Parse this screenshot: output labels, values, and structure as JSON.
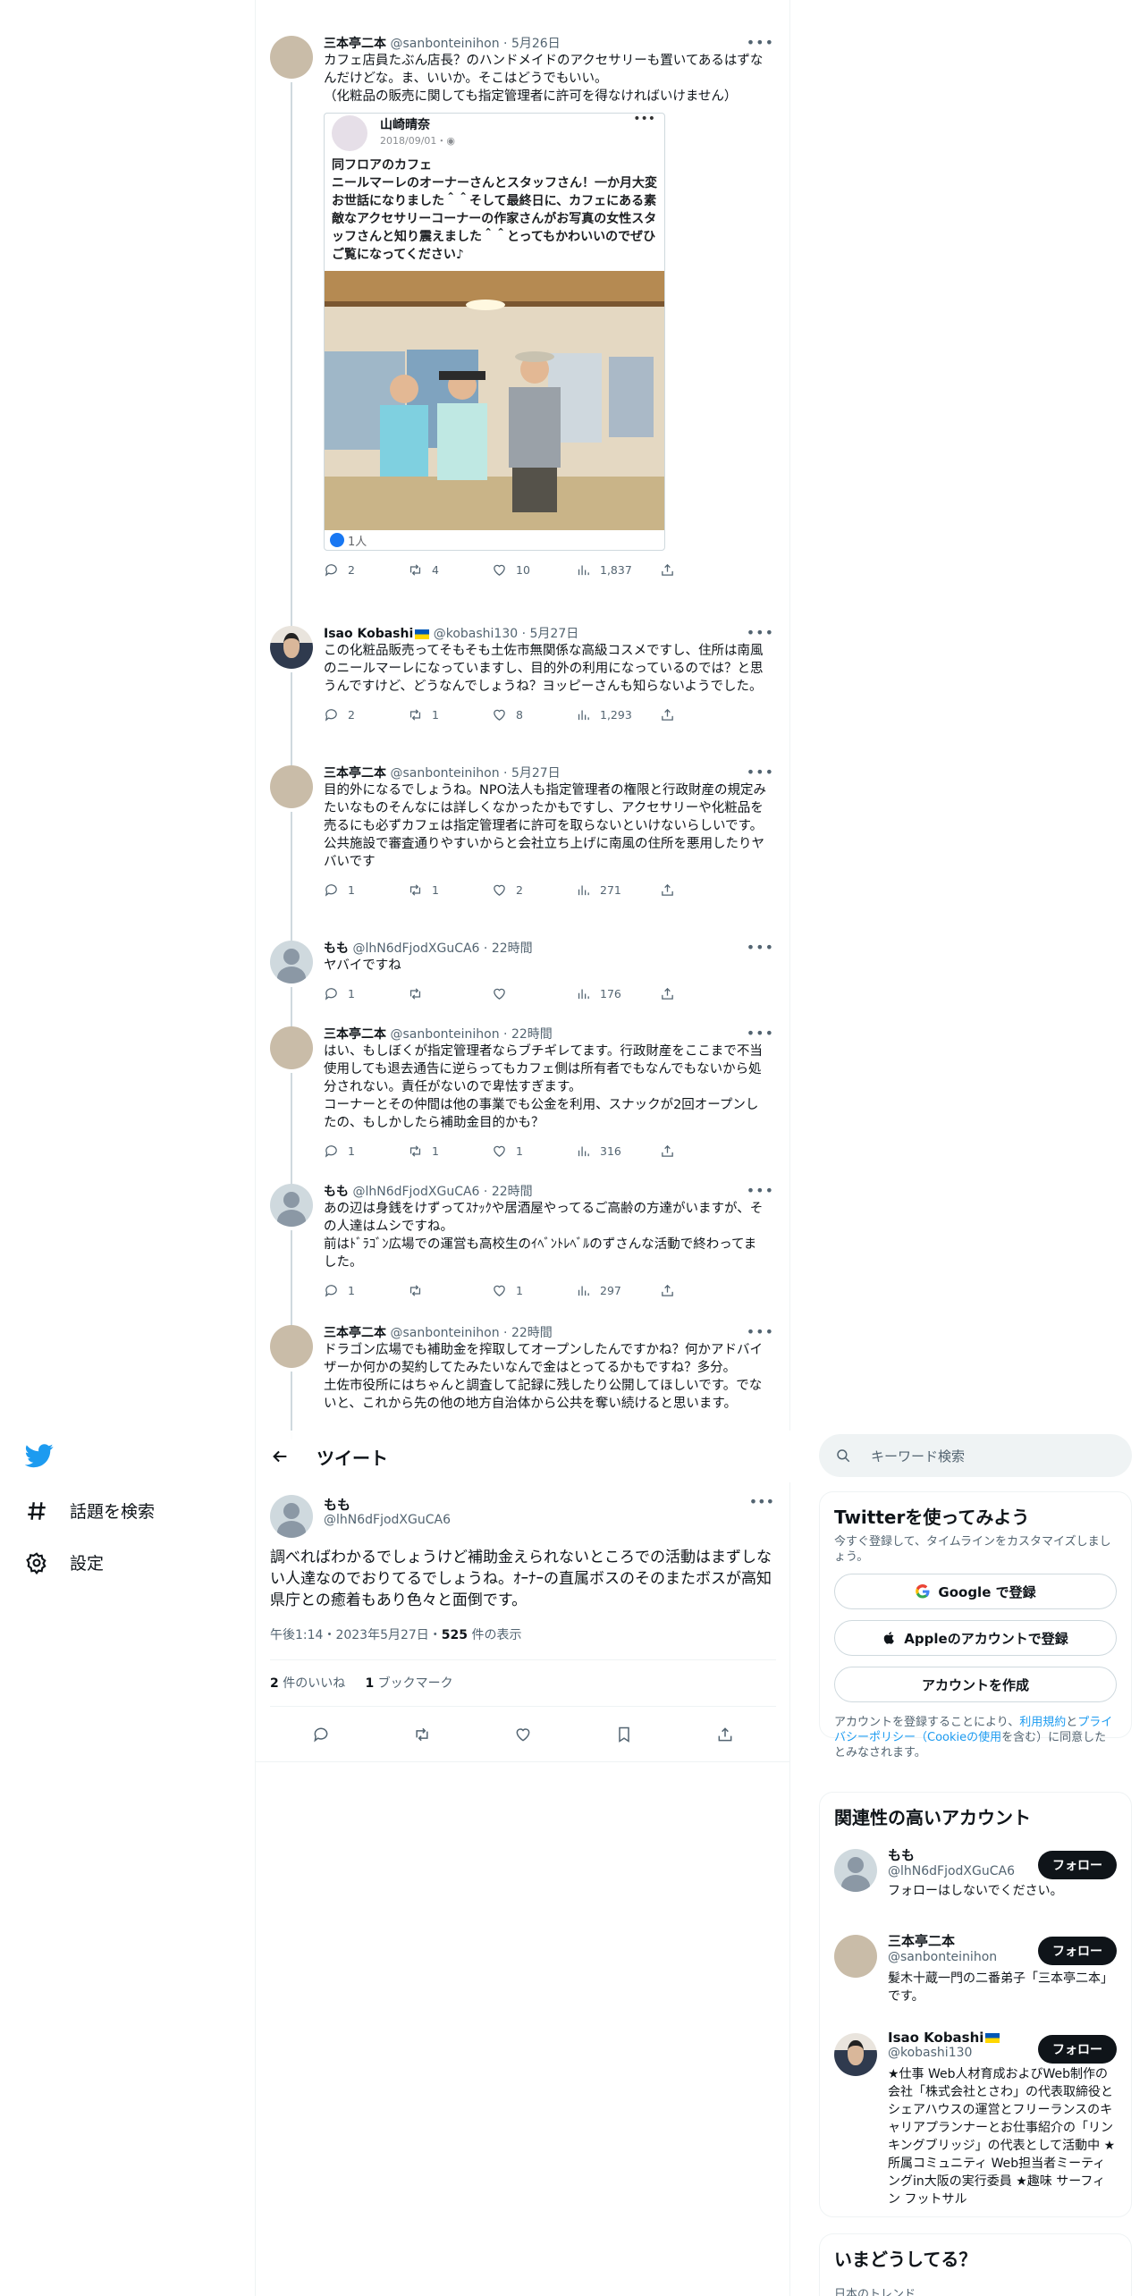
{
  "nav": {
    "explore_label": "話題を検索",
    "settings_label": "設定"
  },
  "thread": [
    {
      "name": "三本亭二本",
      "handle": "@sanbonteinihon",
      "time": "5月26日",
      "text": "カフェ店員たぶん店長？のハンドメイドのアクセサリーも置いてあるはずなんだけどな。ま、いいか。そこはどうでもいい。\n（化粧品の販売に関しても指定管理者に許可を得なければいけません）",
      "embed": {
        "name": "山崎晴奈",
        "date": "2018/09/01・",
        "text": "同フロアのカフェ\nニールマーレのオーナーさんとスタッフさん！一か月大変お世話になりました＾＾そして最終日に、カフェにある素敵なアクセサリーコーナーの作家さんがお写真の女性スタッフさんと知り震えました＾＾とってもかわいいのでぜひご覧になってください♪",
        "likes": "1人"
      },
      "replies": "2",
      "retweets": "4",
      "likes": "10",
      "views": "1,837"
    },
    {
      "name": "Isao Kobashi",
      "handle": "@kobashi130",
      "time": "5月27日",
      "text": "この化粧品販売ってそもそも土佐市無関係な高級コスメですし、住所は南風のニールマーレになっていますし、目的外の利用になっているのでは？と思うんですけど、どうなんでしょうね？ヨッピーさんも知らないようでした。",
      "replies": "2",
      "retweets": "1",
      "likes": "8",
      "views": "1,293"
    },
    {
      "name": "三本亭二本",
      "handle": "@sanbonteinihon",
      "time": "5月27日",
      "text": "目的外になるでしょうね。NPO法人も指定管理者の権限と行政財産の規定みたいなものそんなには詳しくなかったかもですし、アクセサリーや化粧品を売るにも必ずカフェは指定管理者に許可を取らないといけないらしいです。\n公共施設で審査通りやすいからと会社立ち上げに南風の住所を悪用したりヤバいです",
      "replies": "1",
      "retweets": "1",
      "likes": "2",
      "views": "271"
    },
    {
      "name": "もも",
      "handle": "@lhN6dFjodXGuCA6",
      "time": "22時間",
      "text": "ヤバイですね",
      "replies": "1",
      "retweets": "",
      "likes": "",
      "views": "176"
    },
    {
      "name": "三本亭二本",
      "handle": "@sanbonteinihon",
      "time": "22時間",
      "text": "はい、もしぼくが指定管理者ならブチギレてます。行政財産をここまで不当使用しても退去通告に逆らってもカフェ側は所有者でもなんでもないから処分されない。責任がないので卑怯すぎます。\nコーナーとその仲間は他の事業でも公金を利用、スナックが2回オープンしたの、もしかしたら補助金目的かも？",
      "replies": "1",
      "retweets": "1",
      "likes": "1",
      "views": "316"
    },
    {
      "name": "もも",
      "handle": "@lhN6dFjodXGuCA6",
      "time": "22時間",
      "text": "あの辺は身銭をけずってｽﾅｯｸや居酒屋やってるご高齢の方達がいますが、その人達はムシですね。\n前はﾄﾞﾗｺﾞﾝ広場での運営も高校生のｲﾍﾞﾝﾄﾚﾍﾞﾙのずさんな活動で終わってました。",
      "replies": "1",
      "retweets": "",
      "likes": "1",
      "views": "297"
    },
    {
      "name": "三本亭二本",
      "handle": "@sanbonteinihon",
      "time": "22時間",
      "text": "ドラゴン広場でも補助金を搾取してオープンしたんですかね？何かアドバイザーか何かの契約してたみたいなんで金はとってるかもですね？多分。\n土佐市役所にはちゃんと調査して記録に残したり公開してほしいです。でないと、これから先の他の地方自治体から公共を奪い続けると思います。",
      "replies": "",
      "retweets": "",
      "likes": "",
      "views": ""
    }
  ],
  "header": {
    "title": "ツイート"
  },
  "detail": {
    "name": "もも",
    "handle": "@lhN6dFjodXGuCA6",
    "text": "調べればわかるでしょうけど補助金えられないところでの活動はまずしない人達なのでおりてるでしょうね。ｵｰﾅｰの直属ボスのそのまたボスが高知県庁との癒着もあり色々と面倒です。",
    "time_prefix": "午後1:14・2023年5月27日・",
    "views_count": "525",
    "views_suffix": " 件の表示",
    "likes_count": "2",
    "likes_suffix": " 件のいいね",
    "bookmarks_count": "1",
    "bookmarks_suffix": " ブックマーク"
  },
  "search": {
    "placeholder": "キーワード検索"
  },
  "signup": {
    "title": "Twitterを使ってみよう",
    "subtitle": "今すぐ登録して、タイムラインをカスタマイズしましょう。",
    "google": "Google で登録",
    "apple": "Appleのアカウントで登録",
    "create": "アカウントを作成",
    "legal_a": "アカウントを登録することにより、",
    "legal_terms": "利用規約",
    "legal_b": "と",
    "legal_privacy": "プライバシーポリシー",
    "legal_cookie": "（Cookieの使用",
    "legal_c": "を含む）に同意したとみなされます。"
  },
  "related": {
    "title": "関連性の高いアカウント",
    "follow_label": "フォロー",
    "accounts": [
      {
        "name": "もも",
        "handle": "@lhN6dFjodXGuCA6",
        "bio": "フォローはしないでください。"
      },
      {
        "name": "三本亭二本",
        "handle": "@sanbonteinihon",
        "bio": "髪木十蔵一門の二番弟子「三本亭二本」です。"
      },
      {
        "name": "Isao Kobashi",
        "handle": "@kobashi130",
        "bio": "★仕事 Web人材育成およびWeb制作の会社「株式会社とさわ」の代表取締役とシェアハウスの運営とフリーランスのキャリアプランナーとお仕事紹介の「リンキングブリッジ」の代表として活動中 ★所属コミュニティ Web担当者ミーティングin大阪の実行委員 ★趣味 サーフィン フットサル"
      }
    ]
  },
  "trends": {
    "title": "いまどうしてる？",
    "sub": "日本のトレンド"
  },
  "colors": {
    "accent": "#1d9bf0",
    "text": "#0f1419",
    "muted": "#536471",
    "border": "#eff3f4"
  }
}
